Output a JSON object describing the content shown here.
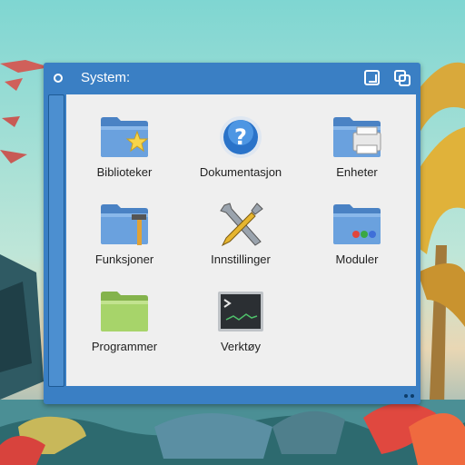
{
  "window": {
    "title": "System:"
  },
  "items": [
    {
      "label": "Biblioteker",
      "icon": "folder-favorites-icon"
    },
    {
      "label": "Dokumentasjon",
      "icon": "help-icon"
    },
    {
      "label": "Enheter",
      "icon": "folder-devices-icon"
    },
    {
      "label": "Funksjoner",
      "icon": "folder-functions-icon"
    },
    {
      "label": "Innstillinger",
      "icon": "settings-tools-icon"
    },
    {
      "label": "Moduler",
      "icon": "folder-modules-icon"
    },
    {
      "label": "Programmer",
      "icon": "folder-programs-icon"
    },
    {
      "label": "Verktøy",
      "icon": "terminal-icon"
    }
  ],
  "colors": {
    "window_frame": "#3a7fc4",
    "content_bg": "#efefef",
    "folder_blue": "#5b93d3",
    "folder_green": "#9ccc65"
  }
}
